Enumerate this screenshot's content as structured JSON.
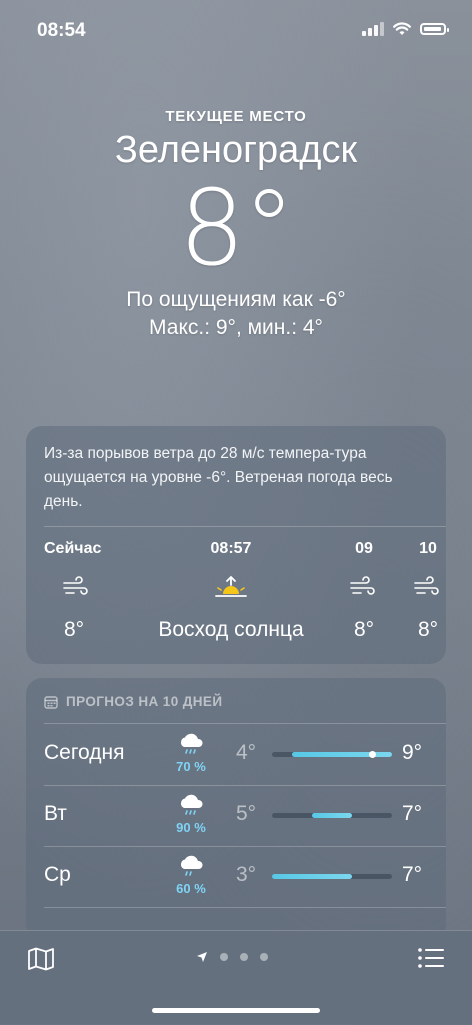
{
  "status_bar": {
    "time": "08:54"
  },
  "header": {
    "location_label": "ТЕКУЩЕЕ МЕСТО",
    "city": "Зеленоградск",
    "temperature": "8°",
    "feels_like": "По ощущениям как -6°",
    "min_max": "Макс.: 9°, мин.: 4°"
  },
  "hourly": {
    "summary": "Из-за порывов ветра до 28 м/с темпера-тура ощущается на уровне -6°. Ветреная погода весь день.",
    "items": [
      {
        "label": "Сейчас",
        "icon": "wind-icon",
        "value": "8°"
      },
      {
        "label": "08:57",
        "icon": "sunrise-icon",
        "value": "Восход солнца"
      },
      {
        "label": "09",
        "icon": "wind-icon",
        "value": "8°"
      },
      {
        "label": "10",
        "icon": "wind-icon",
        "value": "8°"
      }
    ]
  },
  "daily": {
    "header": "ПРОГНОЗ НА 10 ДНЕЙ",
    "scale": {
      "min": 3,
      "max": 9
    },
    "days": [
      {
        "name": "Сегодня",
        "icon": "rain-cloud-icon",
        "precip": "70 %",
        "low": "4°",
        "high": "9°",
        "low_value": 4,
        "high_value": 9,
        "current_value": 8
      },
      {
        "name": "Вт",
        "icon": "rain-cloud-icon",
        "precip": "90 %",
        "low": "5°",
        "high": "7°",
        "low_value": 5,
        "high_value": 7
      },
      {
        "name": "Ср",
        "icon": "rain-cloud-icon",
        "precip": "60 %",
        "low": "3°",
        "high": "7°",
        "low_value": 3,
        "high_value": 7
      }
    ]
  },
  "colors": {
    "precip": "#7fd3f5",
    "range_bar": "#5ccbe8",
    "sun": "#f5c518"
  }
}
